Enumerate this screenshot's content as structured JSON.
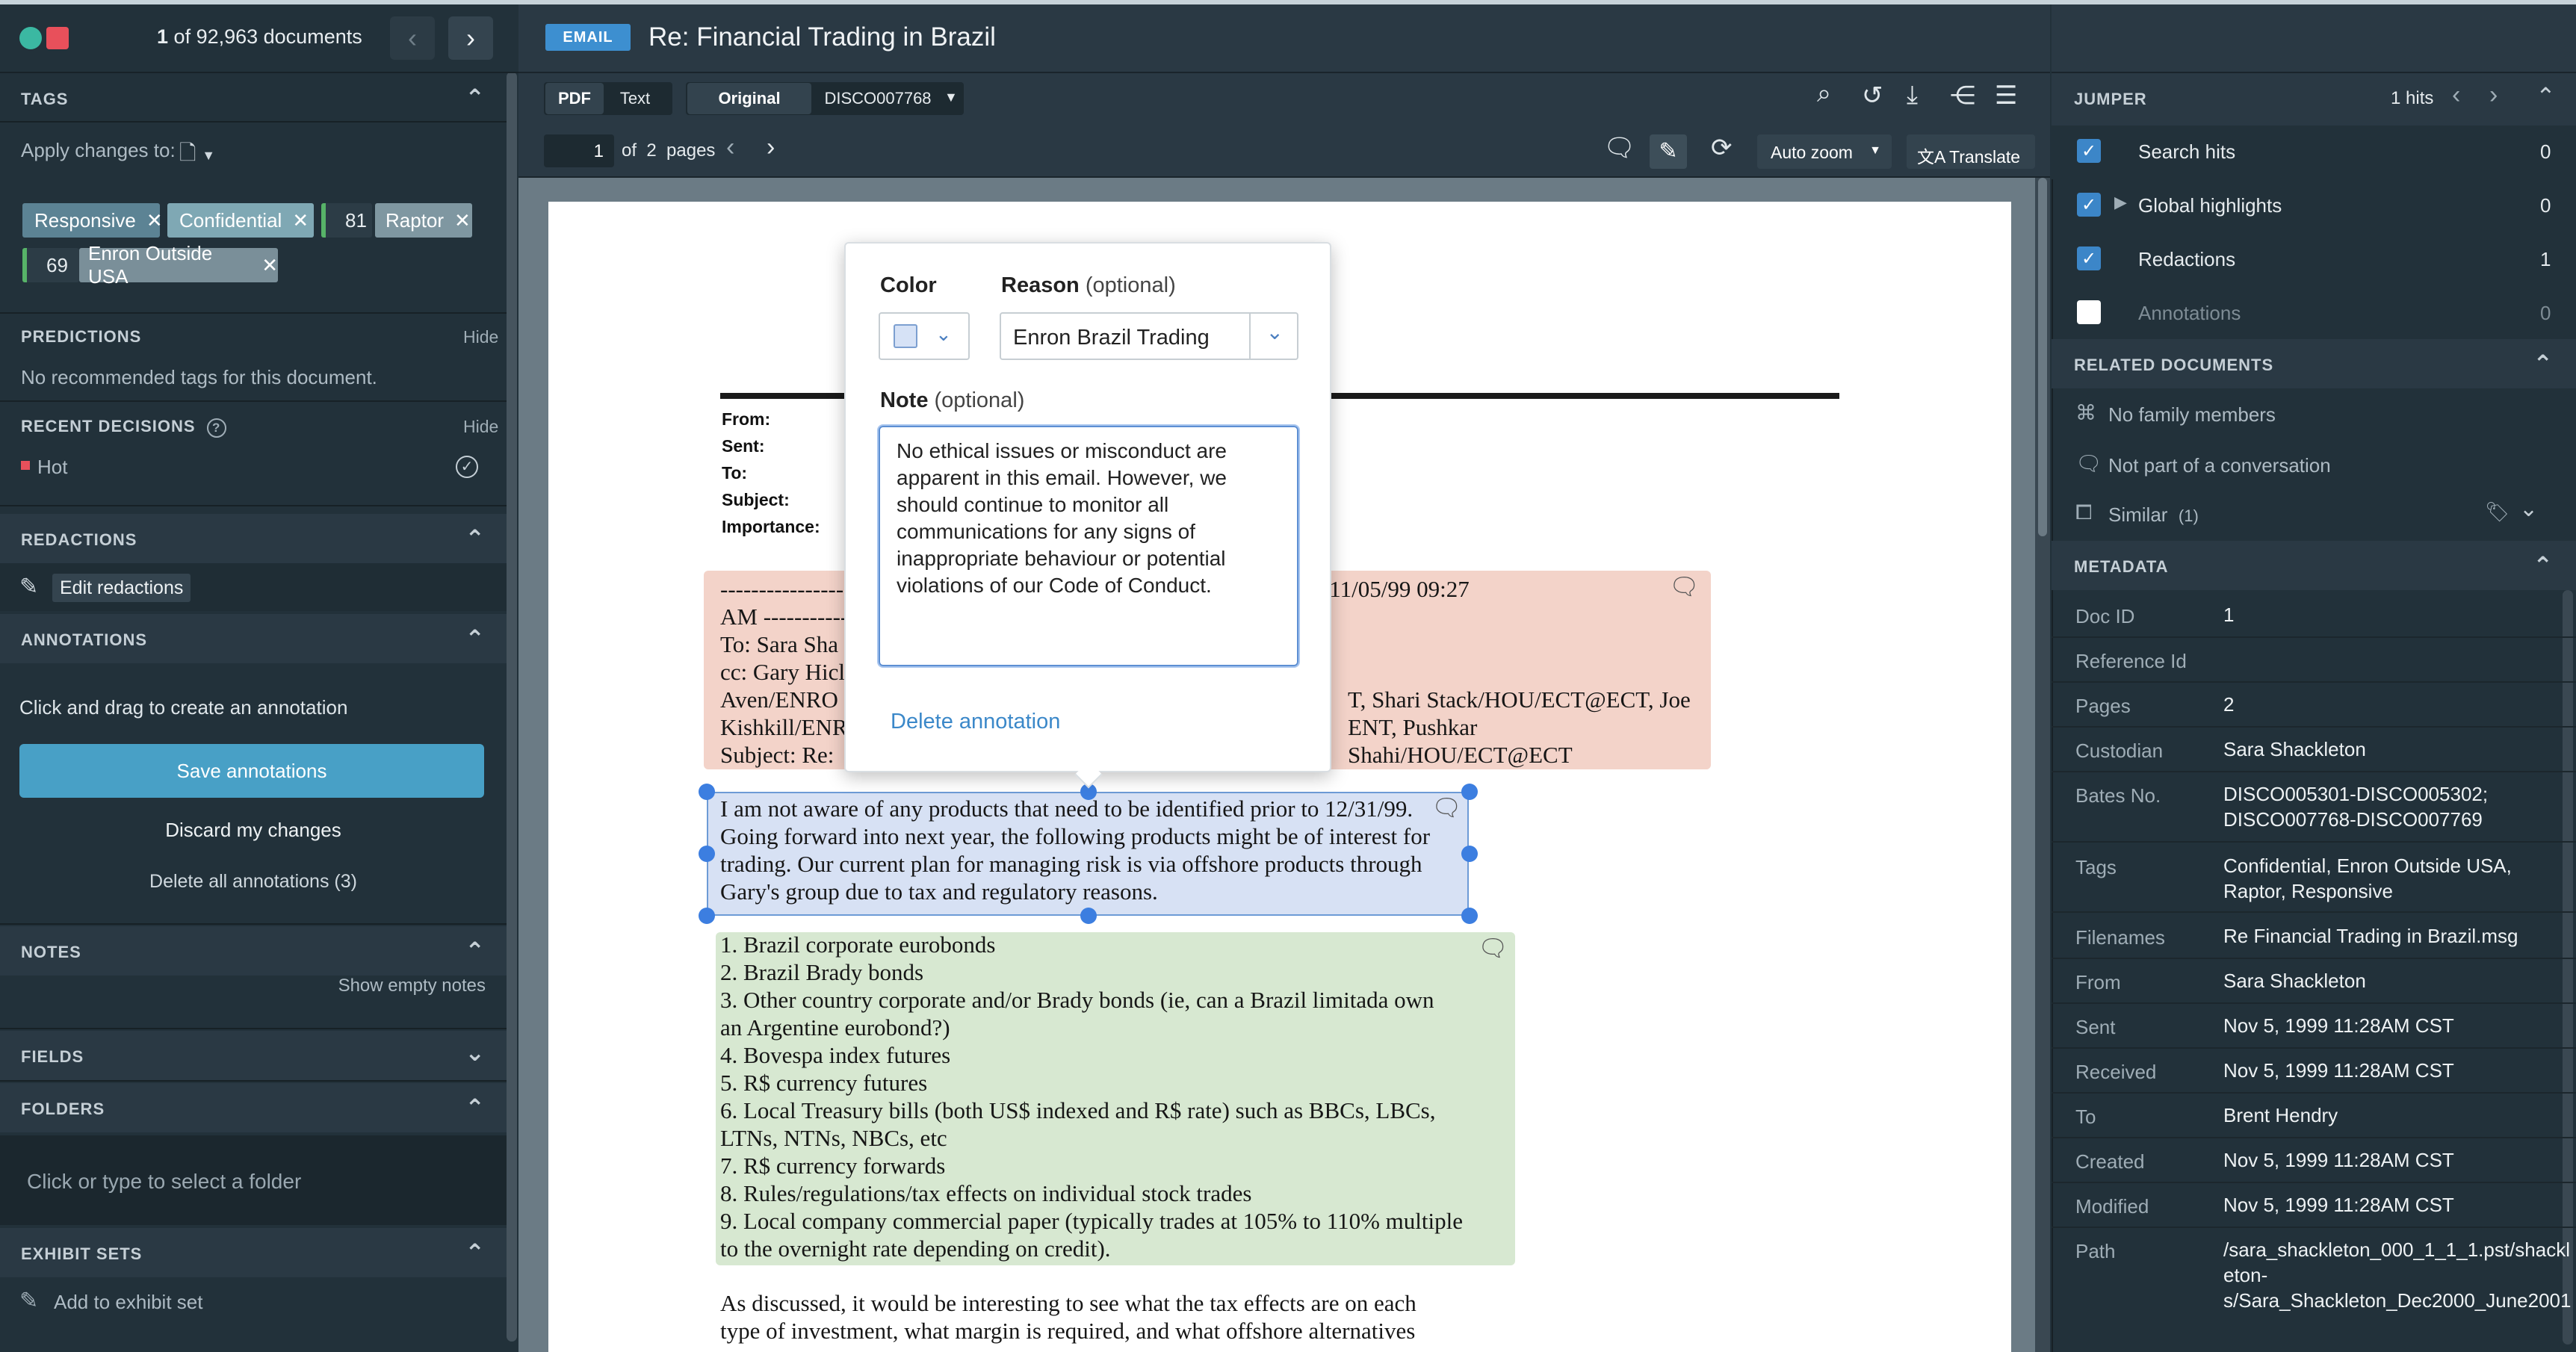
{
  "left": {
    "doc_counter": {
      "current": "1",
      "of_text": "of 92,963 documents"
    },
    "tags_header": "TAGS",
    "apply_changes_label": "Apply changes to:",
    "tags": [
      {
        "label": "Responsive"
      },
      {
        "label": "Confidential"
      },
      {
        "count": "81",
        "label": "Raptor"
      },
      {
        "count": "69",
        "label": "Enron Outside USA"
      }
    ],
    "predictions": {
      "title": "PREDICTIONS",
      "hide": "Hide",
      "text": "No recommended tags for this document."
    },
    "recent_decisions": {
      "title": "RECENT DECISIONS",
      "hide": "Hide",
      "item": "Hot"
    },
    "redactions": {
      "title": "REDACTIONS",
      "edit": "Edit redactions"
    },
    "annotations": {
      "title": "ANNOTATIONS",
      "hint": "Click and drag to create an annotation",
      "save": "Save annotations",
      "discard": "Discard my changes",
      "delete_all": "Delete all annotations (3)"
    },
    "notes": {
      "title": "NOTES",
      "show_empty": "Show empty notes"
    },
    "fields": {
      "title": "FIELDS"
    },
    "folders": {
      "title": "FOLDERS",
      "placeholder": "Click or type to select a folder"
    },
    "exhibit_sets": {
      "title": "EXHIBIT SETS",
      "add": "Add to exhibit set"
    }
  },
  "center": {
    "badge": "EMAIL",
    "title": "Re: Financial Trading in Brazil",
    "view_tabs": [
      "PDF",
      "Text"
    ],
    "version": "Original",
    "doc_code": "DISCO007768",
    "page_input": "1",
    "page_of": "of  2  pages",
    "zoom": "Auto zoom",
    "translate": "Translate",
    "email_header_labels": [
      "From:",
      "Sent:",
      "To:",
      "Subject:",
      "Importance:"
    ],
    "red_block": [
      {
        "left": "------------------",
        "right": "n 11/05/99 09:27"
      },
      {
        "left": "AM -----------",
        "right": ""
      },
      {
        "left": "To: Sara Sha",
        "right": ""
      },
      {
        "left": "cc: Gary Hicl",
        "right": ""
      },
      {
        "left": "Aven/ENRO",
        "right": "T, Shari Stack/HOU/ECT@ECT, Joe"
      },
      {
        "left": "Kishkill/ENR",
        "right": "ENT, Pushkar Shahi/HOU/ECT@ECT"
      },
      {
        "left": "Subject: Re:",
        "right": ""
      }
    ],
    "blue_block": [
      "I am not aware of any products that need to be identified prior to 12/31/99.",
      "Going forward into next year, the following products might be of interest for",
      "trading.  Our current plan for managing risk is via offshore products through",
      "Gary's group due to tax and regulatory reasons."
    ],
    "green_block": [
      "1. Brazil corporate eurobonds",
      "2. Brazil Brady bonds",
      "3. Other country corporate and/or Brady bonds (ie, can a Brazil limitada own",
      "an Argentine eurobond?)",
      "4. Bovespa index futures",
      "5. R$ currency futures",
      "6. Local Treasury bills (both US$ indexed and R$ rate) such as BBCs, LBCs,",
      "LTNs, NTNs, NBCs, etc",
      "7. R$ currency forwards",
      "8. Rules/regulations/tax effects on individual stock trades",
      "9. Local company commercial paper (typically trades at 105% to 110% multiple",
      "to the overnight rate depending on credit)."
    ],
    "tail_block": [
      "As discussed, it would be interesting to see what the tax effects are on each",
      "type of investment, what margin is required, and what offshore alternatives"
    ],
    "popup": {
      "color_label": "Color",
      "reason_label": "Reason",
      "optional": "(optional)",
      "reason_value": "Enron Brazil Trading",
      "note_label": "Note",
      "note_text": "No ethical issues or misconduct are apparent in this email. However, we should continue to monitor all communications for any signs of inappropriate behaviour or potential violations of our Code of Conduct.",
      "delete": "Delete annotation"
    }
  },
  "right": {
    "jumper": {
      "title": "JUMPER",
      "hits": "1 hits",
      "items": [
        {
          "label": "Search hits",
          "count": "0",
          "checked": true
        },
        {
          "label": "Global highlights",
          "count": "0",
          "checked": true
        },
        {
          "label": "Redactions",
          "count": "1",
          "checked": true
        },
        {
          "label": "Annotations",
          "count": "0",
          "checked": false
        }
      ]
    },
    "related": {
      "title": "RELATED DOCUMENTS",
      "family": "No family members",
      "conversation": "Not part of a conversation",
      "similar": "Similar",
      "similar_count": "(1)"
    },
    "metadata": {
      "title": "METADATA",
      "rows": [
        {
          "label": "Doc ID",
          "value": "1"
        },
        {
          "label": "Reference Id",
          "value": ""
        },
        {
          "label": "Pages",
          "value": "2"
        },
        {
          "label": "Custodian",
          "value": "Sara Shackleton"
        },
        {
          "label": "Bates No.",
          "value": "DISCO005301-DISCO005302;\nDISCO007768-DISCO007769"
        },
        {
          "label": "Tags",
          "value": "Confidential, Enron Outside USA,\nRaptor, Responsive"
        },
        {
          "label": "Filenames",
          "value": "Re Financial Trading in Brazil.msg"
        },
        {
          "label": "From",
          "value": "Sara Shackleton"
        },
        {
          "label": "Sent",
          "value": "Nov 5, 1999 11:28AM CST"
        },
        {
          "label": "Received",
          "value": "Nov 5, 1999 11:28AM CST"
        },
        {
          "label": "To",
          "value": "Brent Hendry"
        },
        {
          "label": "Created",
          "value": "Nov 5, 1999 11:28AM CST"
        },
        {
          "label": "Modified",
          "value": "Nov 5, 1999 11:28AM CST"
        },
        {
          "label": "Path",
          "value": "/sara_shackleton_000_1_1_1.pst/shackl\neton-\ns/Sara_Shackleton_Dec2000_June2001"
        }
      ]
    }
  }
}
